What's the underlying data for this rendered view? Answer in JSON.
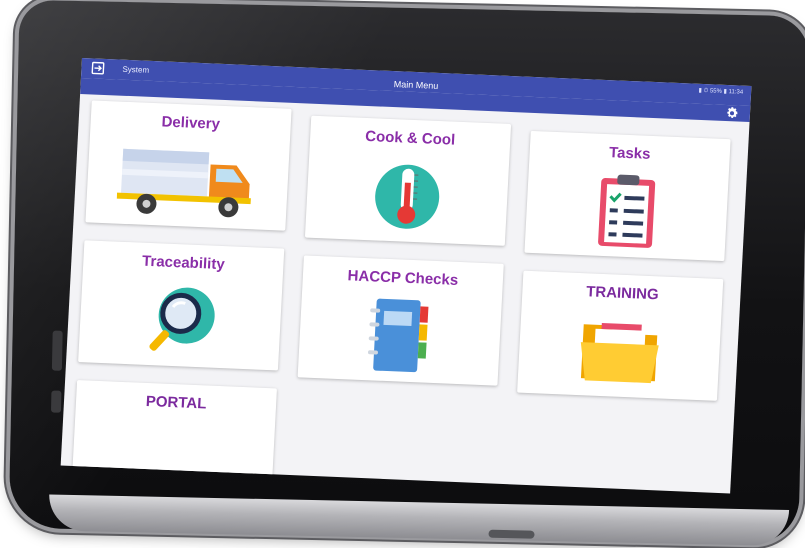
{
  "statusbar": {
    "app_name": "System",
    "title": "Main Menu",
    "indicators": "▮ ⏱ 55% ▮ 11:34",
    "colors": {
      "bar": "#3f4fb0"
    }
  },
  "icons": {
    "exit": "exit-icon",
    "settings": "gear-icon"
  },
  "tiles": [
    {
      "label": "Delivery",
      "icon": "delivery-truck-icon"
    },
    {
      "label": "Cook & Cool",
      "icon": "thermometer-icon"
    },
    {
      "label": "Tasks",
      "icon": "clipboard-checklist-icon"
    },
    {
      "label": "Traceability",
      "icon": "magnifier-icon"
    },
    {
      "label": "HACCP Checks",
      "icon": "notebook-icon"
    },
    {
      "label": "TRAINING",
      "icon": "folder-icon"
    },
    {
      "label": "PORTAL",
      "icon": ""
    }
  ],
  "colors": {
    "tile_text": "#8a2ea8",
    "screen_bg": "#f3f3f6"
  }
}
